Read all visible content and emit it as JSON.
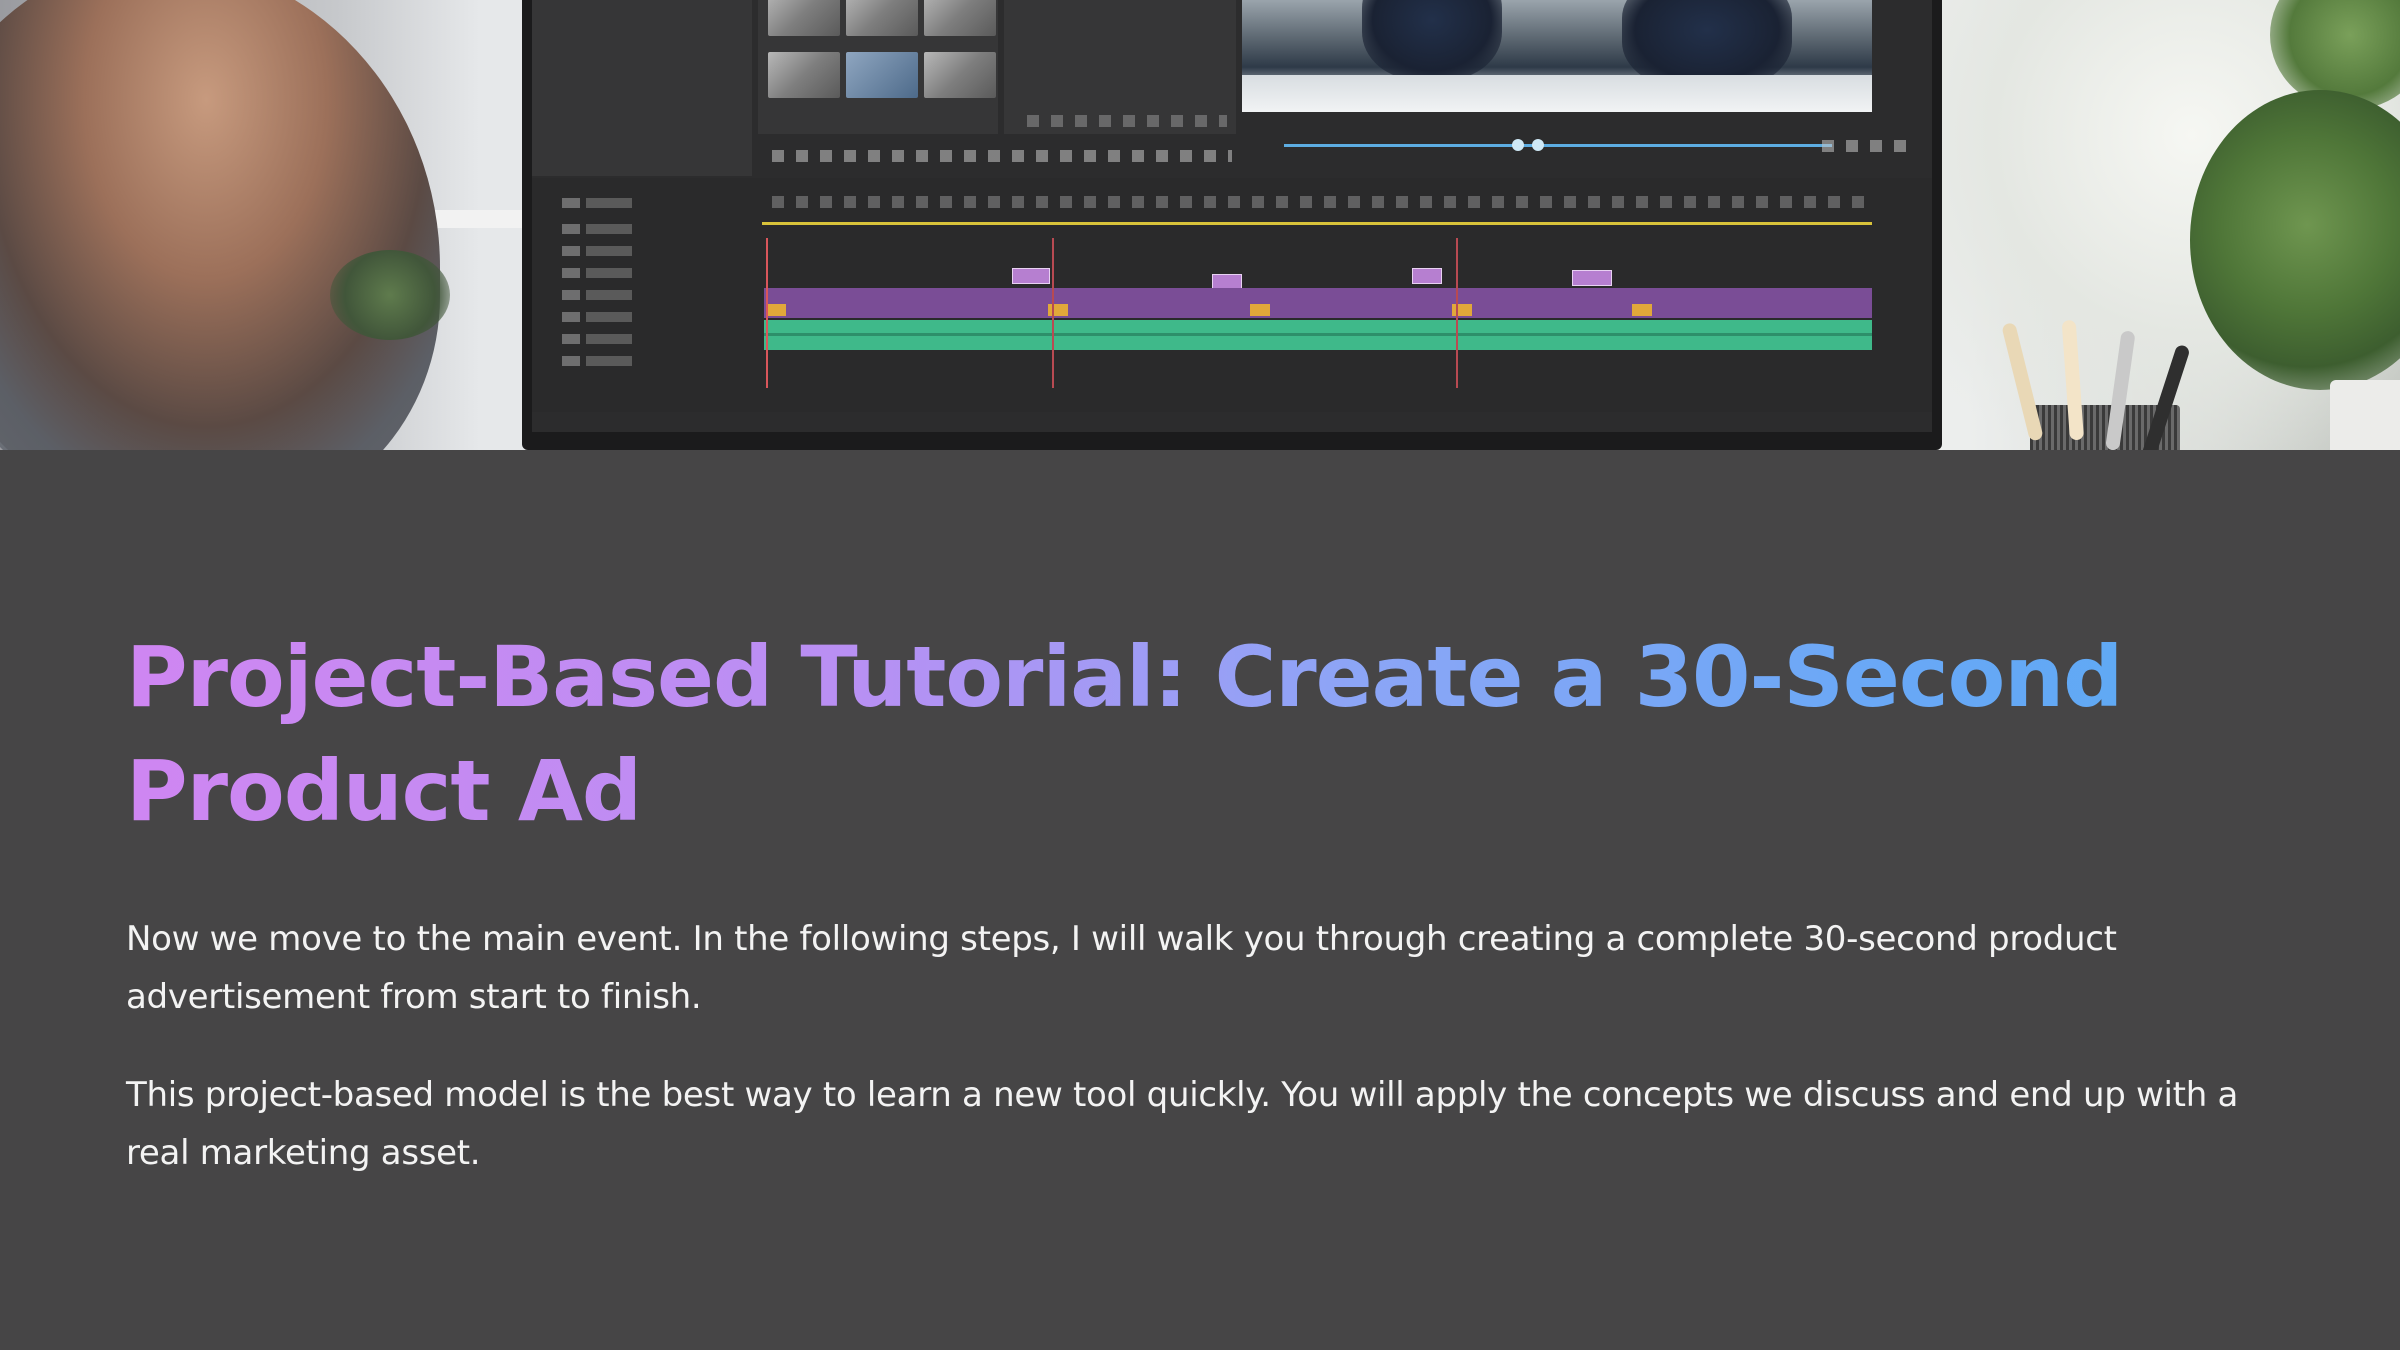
{
  "hero": {
    "image_icon": "video-editing-photo"
  },
  "slide": {
    "title": "Project-Based Tutorial: Create a 30-Second Product Ad",
    "paragraphs": [
      "Now we move to the main event. In the following steps, I will walk you through creating a complete 30-second product advertisement from start to finish.",
      "This project-based model is the best way to learn a new tool quickly. You will apply the concepts we discuss and end up with a real marketing asset."
    ]
  },
  "colors": {
    "background": "#464546",
    "title_gradient_start": "#cf86f2",
    "title_gradient_end": "#5ea9f4",
    "body_text": "#f3f3f3"
  }
}
